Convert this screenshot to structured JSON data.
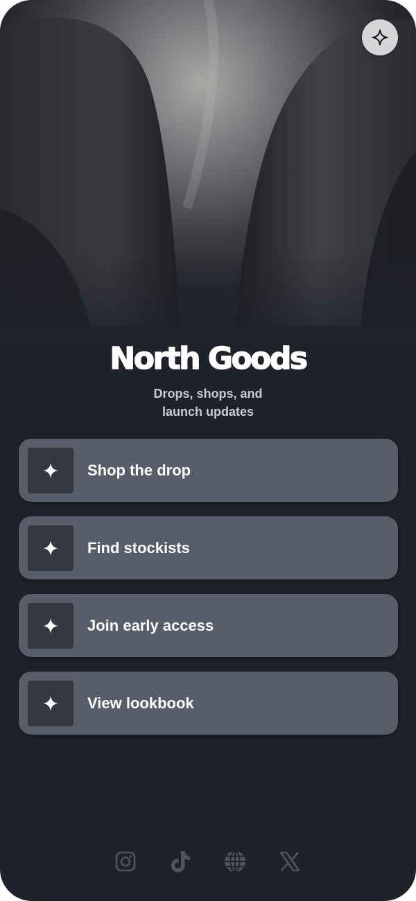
{
  "profile": {
    "title": "North Goods",
    "subtitle_line1": "Drops, shops, and",
    "subtitle_line2": "launch updates"
  },
  "header": {
    "share_icon": "sparkle-icon"
  },
  "links": [
    {
      "label": "Shop the drop",
      "icon": "sparkle-icon"
    },
    {
      "label": "Find stockists",
      "icon": "sparkle-icon"
    },
    {
      "label": "Join early access",
      "icon": "sparkle-icon"
    },
    {
      "label": "View lookbook",
      "icon": "sparkle-icon"
    }
  ],
  "socials": [
    "instagram-icon",
    "tiktok-icon",
    "globe-icon",
    "x-icon"
  ],
  "colors": {
    "background": "#1f222a",
    "button": "#575e69",
    "thumb": "#343941",
    "text": "#ffffff",
    "subtitle": "#c9ccd3",
    "social_icon": "#4e5560",
    "share_button": "#d6d6d8"
  }
}
